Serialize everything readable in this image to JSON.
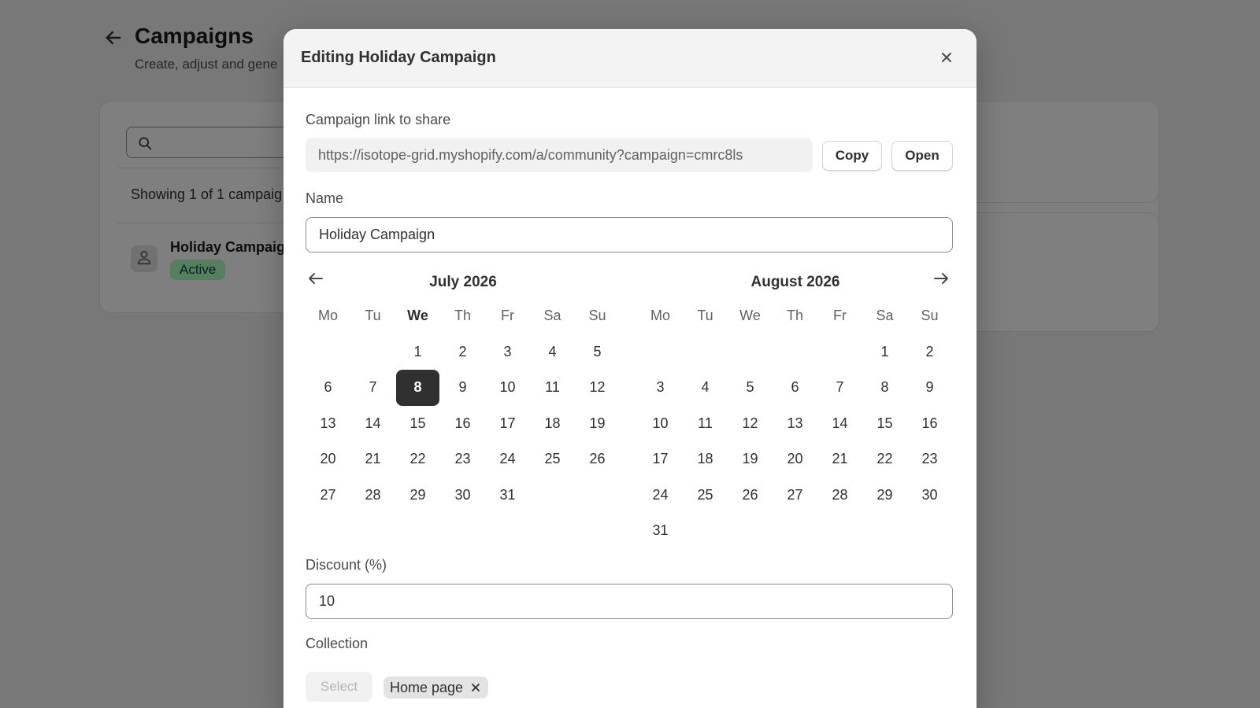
{
  "background": {
    "page_title": "Campaigns",
    "page_subtitle": "Create, adjust and gene",
    "search_placeholder": "",
    "showing_text": "Showing 1 of 1 campaig",
    "campaign_name": "Holiday Campaig",
    "campaign_status": "Active"
  },
  "modal": {
    "title": "Editing Holiday Campaign",
    "link_label": "Campaign link to share",
    "link_value": "https://isotope-grid.myshopify.com/a/community?campaign=cmrc8ls",
    "copy_label": "Copy",
    "open_label": "Open",
    "name_label": "Name",
    "name_value": "Holiday Campaign",
    "discount_label": "Discount (%)",
    "discount_value": "10",
    "collection_label": "Collection",
    "collection_select_label": "Select",
    "collection_tag": "Home page"
  },
  "calendar": {
    "weekdays": [
      "Mo",
      "Tu",
      "We",
      "Th",
      "Fr",
      "Sa",
      "Su"
    ],
    "months": [
      {
        "title": "July 2026",
        "offset": 2,
        "days": 31,
        "selected_day": 8,
        "bold_weekday": "We"
      },
      {
        "title": "August 2026",
        "offset": 5,
        "days": 31,
        "selected_day": null,
        "bold_weekday": null
      }
    ]
  },
  "icons": {
    "back": "arrow-left-icon",
    "search": "search-icon",
    "avatar": "person-icon",
    "close": "close-icon",
    "prev_month": "arrow-left-icon",
    "next_month": "arrow-right-icon",
    "tag_remove": "close-icon"
  },
  "colors": {
    "overlay": "rgba(0,0,0,0.5)",
    "selected_day_bg": "#303030",
    "badge_bg": "#affebf",
    "badge_text": "#014b40"
  }
}
